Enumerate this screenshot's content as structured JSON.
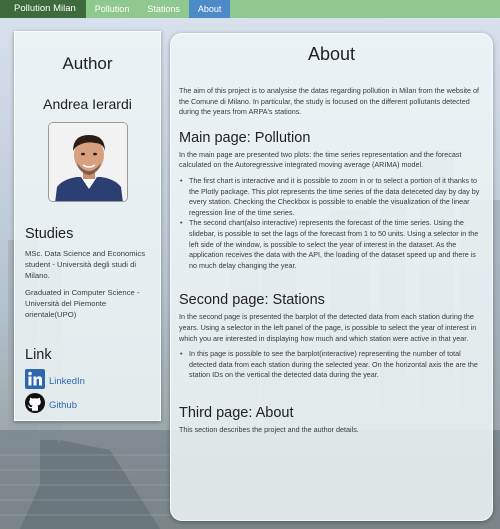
{
  "navbar": {
    "brand": "Pollution Milan",
    "tabs": [
      {
        "label": "Pollution"
      },
      {
        "label": "Stations"
      },
      {
        "label": "About"
      }
    ],
    "active_tab": "About",
    "colors": {
      "bar": "#8fc98f",
      "brand": "#3d6b3d",
      "active": "#4d8ac8"
    }
  },
  "sidebar": {
    "author_heading": "Author",
    "author_name": "Andrea Ierardi",
    "photo_icon": "author-photo",
    "studies_heading": "Studies",
    "studies": [
      "MSc. Data Science and Economics student - Università degli studi di Milano.",
      "Graduated in Computer Science - Università del Piemonte orientale(UPO)"
    ],
    "link_heading": "Link",
    "links": [
      {
        "label": "LinkedIn",
        "icon": "linkedin-icon"
      },
      {
        "label": "Github",
        "icon": "github-icon"
      }
    ],
    "link_color": "#2f66b0"
  },
  "main": {
    "title": "About",
    "intro": "The aim of this project is to analysise the datas regarding pollution in Milan from the website of the Comune di Milano. In particular, the study is focused on the different pollutants detected during the years from ARPA's stations.",
    "pollution": {
      "heading": "Main page: Pollution",
      "text": "In the main page are presented two plots: the time series representation and the forecast calculated on the Autoregressive integrated moving average (ARIMA) model.",
      "bullets": [
        "The first chart is interactive and it is possible to zoom in or to select a portion of it thanks to the Plotly package. This plot represents the time series of the data deteceted day by day by every station. Checking the Checkbox is possible to enable the visualization of the linear regression line of the time series.",
        "The second chart(also interactive) represents the forecast of the time series. Using the slidebar, is possible to set the lags of the forecast from 1 to 50 units. Using a selector in the left side of the window, is possible to select the year of interest in the dataset. As the application receives the data with the API, the loading of the dataset speed up and there is no much delay changing the year."
      ]
    },
    "stations": {
      "heading": "Second page: Stations",
      "text": "In the second page is presented the barplot of the detected data from each station during the years. Using a selector in the left panel of the page, is possible to select the year of interest in which you are interested in displaying how much and which station were active in that year.",
      "bullets": [
        "In this page is possible to see the barplot(interactive) representing the number of total detected data from each station during the selected year. On the horizontal axis the are the station IDs on the vertical the detected data during the year."
      ]
    },
    "about": {
      "heading": "Third page: About",
      "text": "This section describes the project and the author details."
    }
  }
}
